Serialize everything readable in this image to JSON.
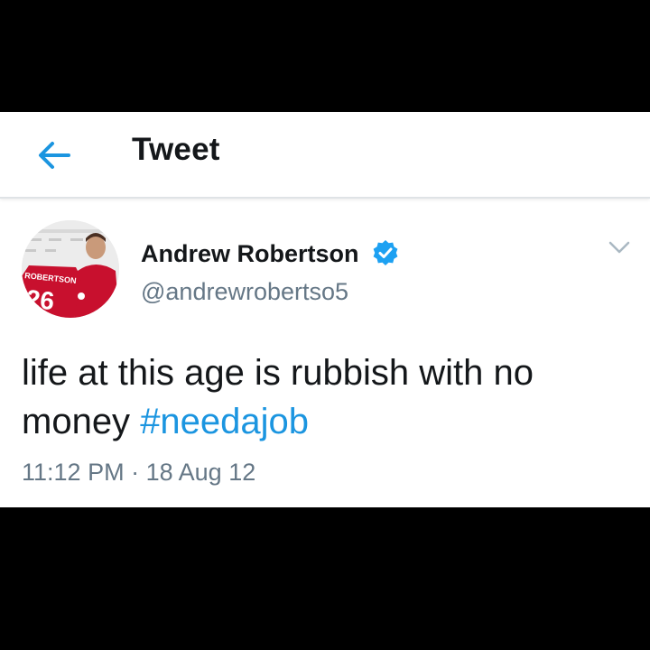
{
  "header": {
    "title": "Tweet",
    "back_icon": "arrow-left-icon"
  },
  "tweet": {
    "display_name": "Andrew Robertson",
    "handle": "@andrewrobertso5",
    "verified": true,
    "text": "life at this age is rubbish with no money",
    "hashtag": "#needajob",
    "time": "11:12 PM",
    "separator": "·",
    "date": "18 Aug 12",
    "menu_icon": "chevron-down-icon"
  },
  "avatar": {
    "shirt_name": "ROBERTSON",
    "shirt_number": "26"
  },
  "colors": {
    "accent": "#1b95e0",
    "text": "#14171a",
    "secondary": "#657786",
    "verified": "#1da1f2",
    "shirt": "#c8102e"
  }
}
